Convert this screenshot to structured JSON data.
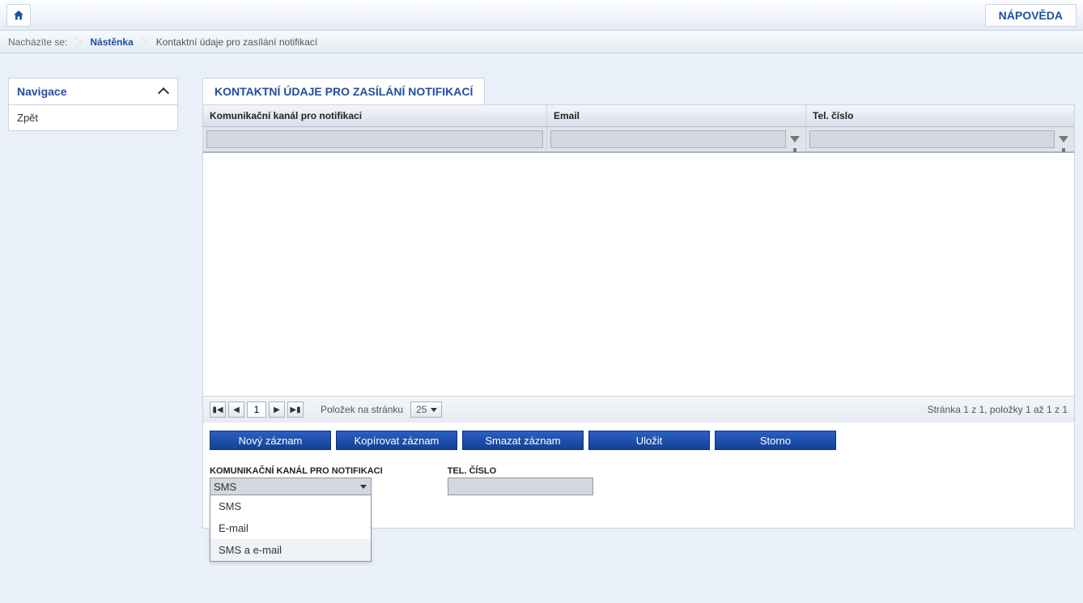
{
  "topbar": {
    "help": "NÁPOVĚDA"
  },
  "breadcrumb": {
    "label": "Nacházíte se:",
    "items": [
      "Nástěnka",
      "Kontaktní údaje pro zasílání notifikací"
    ]
  },
  "sidebar": {
    "title": "Navigace",
    "items": [
      {
        "label": "Zpět"
      }
    ]
  },
  "panel": {
    "title": "KONTAKTNÍ ÚDAJE PRO ZASÍLÁNÍ NOTIFIKACÍ"
  },
  "grid": {
    "columns": [
      "Komunikační kanál pro notifikaci",
      "Email",
      "Tel. číslo"
    ]
  },
  "pager": {
    "page": "1",
    "per_page_label": "Položek na stránku",
    "per_page": "25",
    "status": "Stránka 1 z 1, položky 1 až 1 z 1"
  },
  "actions": [
    "Nový záznam",
    "Kopírovat záznam",
    "Smazat záznam",
    "Uložit",
    "Storno"
  ],
  "form": {
    "channel_label": "KOMUNIKAČNÍ KANÁL PRO NOTIFIKACI",
    "channel_value": "SMS",
    "channel_options": [
      "SMS",
      "E-mail",
      "SMS a e-mail"
    ],
    "tel_label": "TEL. ČÍSLO",
    "tel_value": ""
  }
}
